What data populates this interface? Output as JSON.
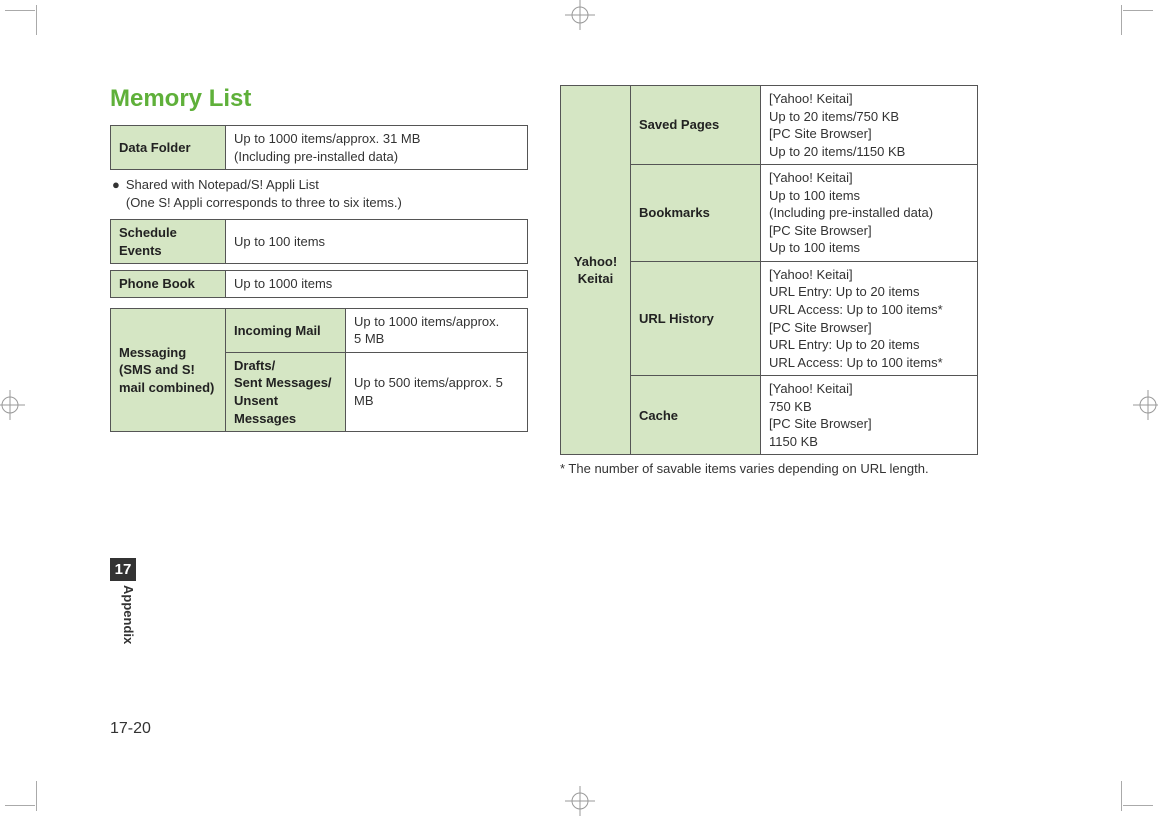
{
  "title": "Memory List",
  "left_tables": {
    "data_folder": {
      "label": "Data Folder",
      "value": "Up to 1000 items/approx. 31 MB\n(Including pre-installed data)"
    },
    "note_line1": "Shared with Notepad/S! Appli List",
    "note_line2": "(One S! Appli corresponds to three to six items.)",
    "schedule": {
      "label": "Schedule\nEvents",
      "value": "Up to 100 items"
    },
    "phonebook": {
      "label": "Phone Book",
      "value": "Up to 1000 items"
    },
    "messaging": {
      "group_label": "Messaging\n(SMS and S!\nmail combined)",
      "incoming_label": "Incoming Mail",
      "incoming_value": "Up to 1000 items/approx.\n5 MB",
      "drafts_label": "Drafts/\nSent Messages/\nUnsent Messages",
      "drafts_value": "Up to 500 items/approx. 5 MB"
    }
  },
  "right_table": {
    "group_label": "Yahoo!\nKeitai",
    "rows": [
      {
        "label": "Saved Pages",
        "value": "[Yahoo! Keitai]\nUp to 20 items/750 KB\n[PC Site Browser]\nUp to 20 items/1150 KB"
      },
      {
        "label": "Bookmarks",
        "value": "[Yahoo! Keitai]\nUp to 100 items\n(Including pre-installed data)\n[PC Site Browser]\nUp to 100 items"
      },
      {
        "label": "URL History",
        "value": "[Yahoo! Keitai]\nURL Entry: Up to 20 items\nURL Access: Up to 100 items*\n[PC Site Browser]\nURL Entry: Up to 20 items\nURL Access: Up to 100 items*"
      },
      {
        "label": "Cache",
        "value": "[Yahoo! Keitai]\n750 KB\n[PC Site Browser]\n1150 KB"
      }
    ],
    "footnote": "* The number of savable items varies depending on URL length."
  },
  "chapter": {
    "number": "17",
    "label": "Appendix"
  },
  "page_number": "17-20"
}
